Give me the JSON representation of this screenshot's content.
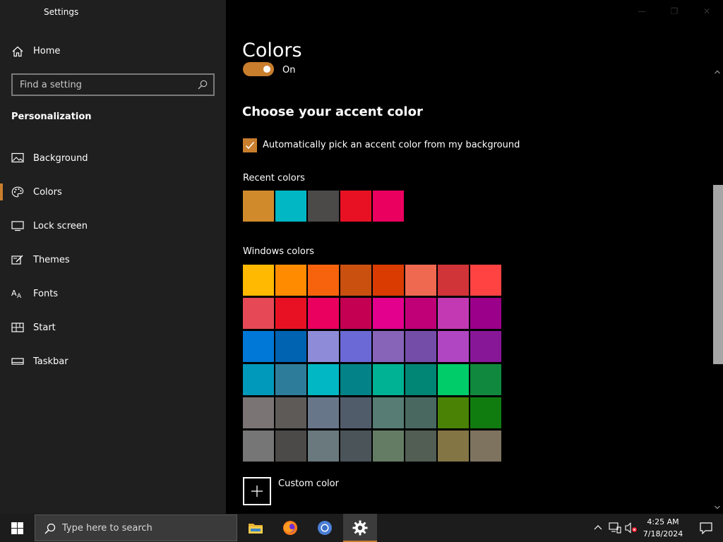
{
  "app": {
    "title": "Settings"
  },
  "sidebar": {
    "home_label": "Home",
    "search_placeholder": "Find a setting",
    "section_title": "Personalization",
    "items": [
      {
        "label": "Background",
        "icon": "image-icon",
        "active": false
      },
      {
        "label": "Colors",
        "icon": "palette-icon",
        "active": true
      },
      {
        "label": "Lock screen",
        "icon": "lock-screen-icon",
        "active": false
      },
      {
        "label": "Themes",
        "icon": "themes-icon",
        "active": false
      },
      {
        "label": "Fonts",
        "icon": "fonts-icon",
        "active": false
      },
      {
        "label": "Start",
        "icon": "start-icon",
        "active": false
      },
      {
        "label": "Taskbar",
        "icon": "taskbar-icon",
        "active": false
      }
    ]
  },
  "main": {
    "title": "Colors",
    "toggle_state": "On",
    "accent_heading": "Choose your accent color",
    "auto_pick_label": "Automatically pick an accent color from my background",
    "auto_pick_checked": true,
    "recent_label": "Recent colors",
    "recent_colors": [
      "#d08a2c",
      "#00b7c3",
      "#4c4a48",
      "#e81123",
      "#ea005e"
    ],
    "windows_label": "Windows colors",
    "windows_colors": [
      "#ffb900",
      "#ff8c00",
      "#f7630c",
      "#ca5010",
      "#da3b01",
      "#ef6950",
      "#d13438",
      "#ff4343",
      "#e74856",
      "#e81123",
      "#ea005e",
      "#c30052",
      "#e3008c",
      "#bf0077",
      "#c239b3",
      "#9a0089",
      "#0078d7",
      "#0063b1",
      "#8e8cd8",
      "#6b69d6",
      "#8764b8",
      "#744da9",
      "#b146c2",
      "#881798",
      "#0099bc",
      "#2d7d9a",
      "#00b7c3",
      "#038387",
      "#00b294",
      "#018574",
      "#00cc6a",
      "#10893e",
      "#7a7574",
      "#5d5a58",
      "#68768a",
      "#515c6b",
      "#567c73",
      "#486860",
      "#498205",
      "#107c10",
      "#767676",
      "#4c4a48",
      "#69797e",
      "#4a5459",
      "#647c64",
      "#525e54",
      "#847545",
      "#7e735f"
    ],
    "custom_color_label": "Custom color"
  },
  "taskbar": {
    "search_placeholder": "Type here to search",
    "time": "4:25 AM",
    "date": "7/18/2024",
    "accent": "#c97e2d"
  }
}
